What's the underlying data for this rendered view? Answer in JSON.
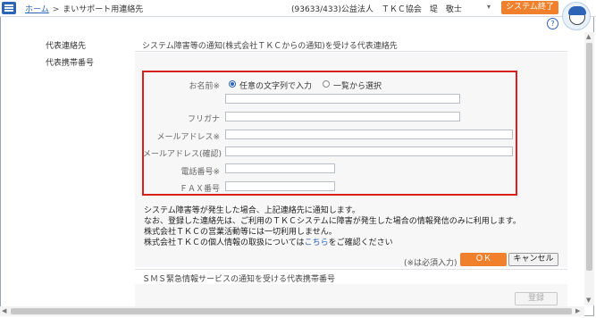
{
  "header": {
    "home_link": "ホーム",
    "separator": ">",
    "page_title": "まいサポート用連絡先",
    "user_info": "(93633/433)公益法人　ＴＫＣ協会　堤　敬士",
    "dropdown_icon": "▾",
    "exit_button": "システム終了",
    "help_icon": "?"
  },
  "left_labels": {
    "rep_contact": "代表連絡先",
    "rep_mobile": "代表携帯番号"
  },
  "section1": {
    "title": "システム障害等の通知(株式会社ＴＫＣからの通知)を受ける代表連絡先"
  },
  "form": {
    "name_label": "お名前※",
    "radio_free": "任意の文字列で入力",
    "radio_select": "一覧から選択",
    "name_value": "",
    "furigana_label": "フリガナ",
    "furigana_value": "",
    "email_label": "メールアドレス※",
    "email_value": "",
    "email_confirm_label": "メールアドレス(確認)",
    "email_confirm_value": "",
    "phone_label": "電話番号※",
    "phone_value": "",
    "fax_label": "ＦＡＸ番号",
    "fax_value": ""
  },
  "notes": {
    "line1": "システム障害等が発生した場合、上記連絡先に通知します。",
    "line2": "なお、登録した連絡先は、ご利用のＴＫＣシステムに障害が発生した場合の情報発信のみに利用します。",
    "line3": "株式会社ＴＫＣの営業活動等には一切利用しません。",
    "line4_prefix": "株式会社ＴＫＣの個人情報の取扱については",
    "line4_link": "こちら",
    "line4_suffix": "をご確認ください"
  },
  "actions": {
    "required_note": "(※は必須入力)",
    "ok_button": "ＯＫ",
    "cancel_button": "キャンセル"
  },
  "section2": {
    "title": "ＳＭＳ緊急情報サービスの通知を受ける代表携帯番号",
    "register_button": "登録"
  },
  "colors": {
    "accent": "#2e64b5",
    "orange": "#f0802b",
    "highlight_red": "#d82020"
  }
}
